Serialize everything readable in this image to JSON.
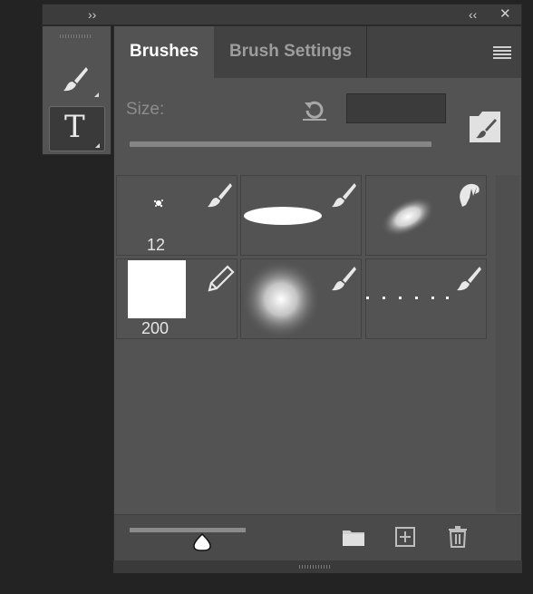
{
  "window": {
    "expand_glyph": "››",
    "collapse_glyph": "‹‹",
    "close_glyph": "✕"
  },
  "tools": [
    {
      "name": "brush-tool",
      "icon": "brush-icon",
      "active": false
    },
    {
      "name": "type-tool",
      "icon": "type-icon",
      "glyph": "T",
      "active": true
    }
  ],
  "tabs": [
    {
      "label": "Brushes",
      "active": true
    },
    {
      "label": "Brush Settings",
      "active": false
    }
  ],
  "size": {
    "label": "Size:",
    "value": "",
    "slider_fraction": 0.0
  },
  "brushes": [
    {
      "type": "brush",
      "label": "12",
      "preview": "spatter"
    },
    {
      "type": "brush",
      "label": "",
      "preview": "hard-ellipse"
    },
    {
      "type": "smudge",
      "label": "",
      "preview": "soft-ellipse"
    },
    {
      "type": "pencil",
      "label": "200",
      "preview": "square"
    },
    {
      "type": "brush",
      "label": "",
      "preview": "soft-round"
    },
    {
      "type": "brush",
      "label": "",
      "preview": "dotted"
    }
  ],
  "footer": {
    "preview_size_fraction": 0.62
  }
}
